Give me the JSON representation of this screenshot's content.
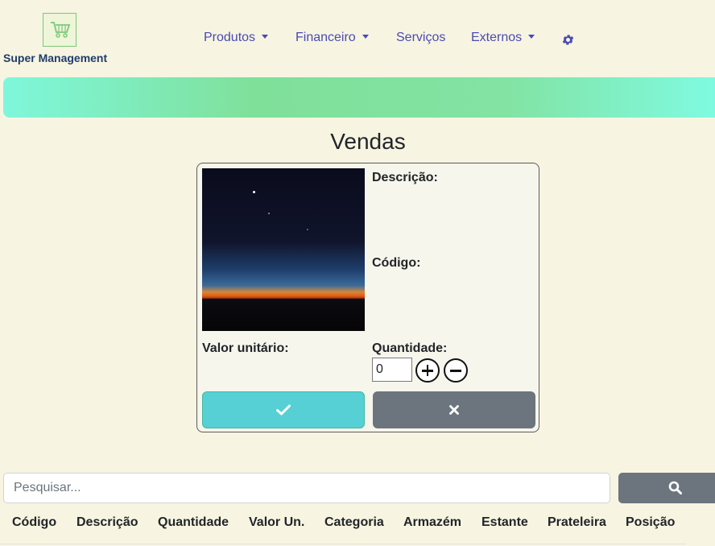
{
  "app": {
    "logo_text": "Super Management"
  },
  "nav": {
    "produtos": "Produtos",
    "financeiro": "Financeiro",
    "servicos": "Serviços",
    "externos": "Externos",
    "settings_icon": "gear-icon"
  },
  "page": {
    "title": "Vendas"
  },
  "product": {
    "description_label": "Descrição:",
    "code_label": "Código:",
    "unit_value_label": "Valor unitário:",
    "quantity_label": "Quantidade:",
    "quantity_value": "0"
  },
  "actions": {
    "confirm_icon": "check-icon",
    "cancel_icon": "close-icon"
  },
  "search": {
    "placeholder": "Pesquisar...",
    "icon": "search-icon"
  },
  "table": {
    "columns": [
      "Código",
      "Descrição",
      "Quantidade",
      "Valor Un.",
      "Categoria",
      "Armazém",
      "Estante",
      "Prateleira",
      "Posição"
    ]
  },
  "colors": {
    "background": "#f7f4e1",
    "nav_link": "#4a4bb3",
    "confirm": "#56d0d4",
    "cancel": "#6c757d"
  }
}
